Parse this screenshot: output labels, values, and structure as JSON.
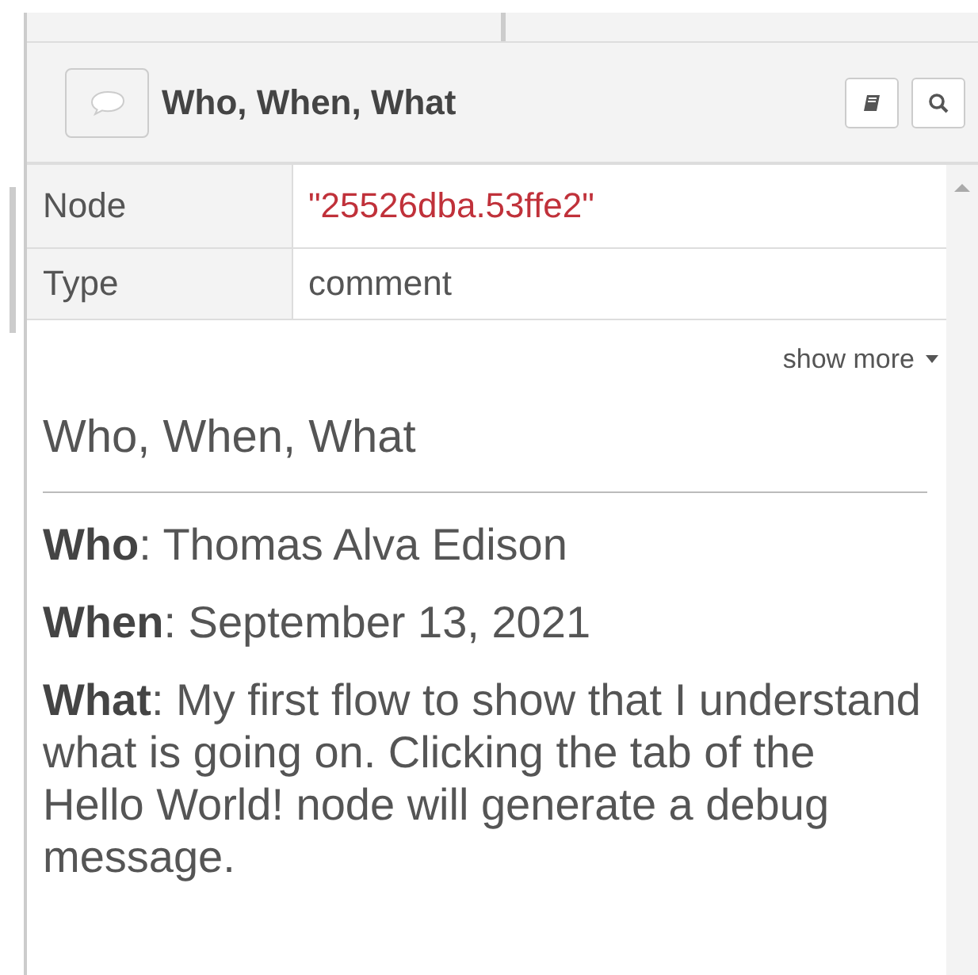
{
  "header": {
    "title": "Who, When, What"
  },
  "properties": [
    {
      "label": "Node",
      "value": "\"25526dba.53ffe2\"",
      "kind": "string"
    },
    {
      "label": "Type",
      "value": "comment",
      "kind": "plain"
    }
  ],
  "show_more": {
    "label": "show more",
    "expanded": false
  },
  "description": {
    "heading": "Who, When, What",
    "paragraphs": [
      "**Who**: Thomas Alva Edison",
      "**When**: September 13, 2021",
      "**What**: My first flow to show that I understand what is going on. Clicking the tab of the Hello World! node will generate a debug message."
    ]
  }
}
